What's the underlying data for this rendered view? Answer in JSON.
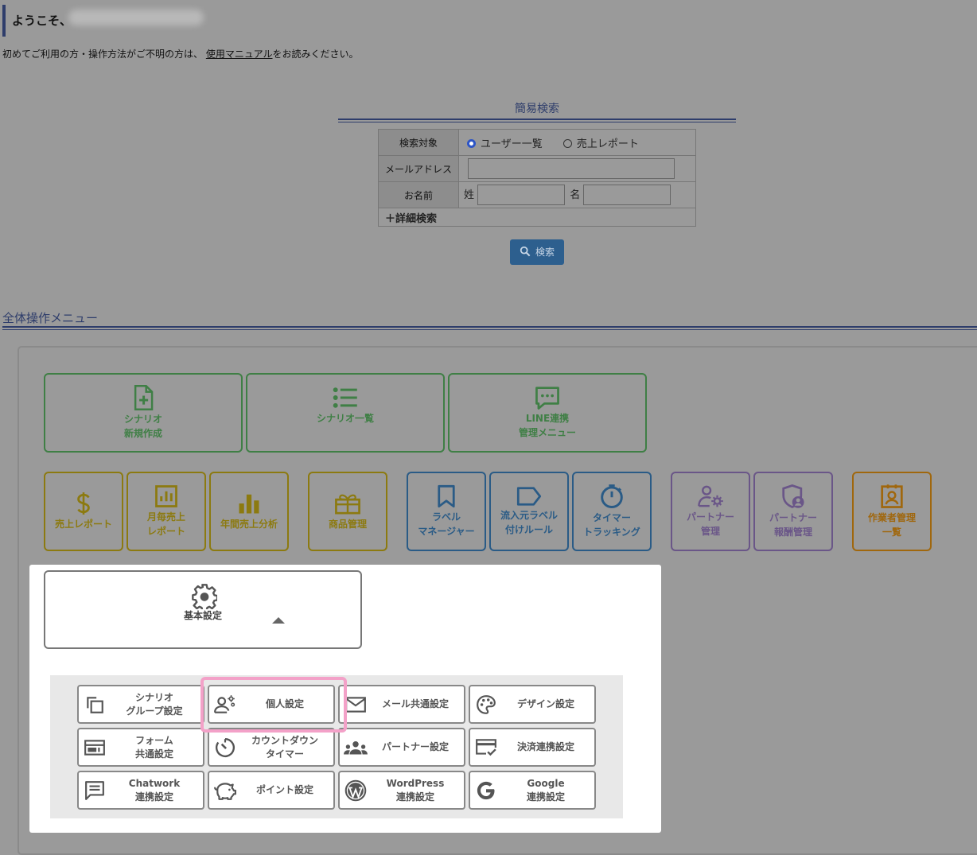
{
  "header": {
    "welcome": "ようこそ、",
    "intro_prefix": "初めてご利用の方・操作方法がご不明の方は、",
    "manual_link": "使用マニュアル",
    "intro_suffix": "をお読みください。"
  },
  "quick_search": {
    "title": "簡易検索",
    "target_label": "検索対象",
    "option_users": "ユーザー一覧",
    "option_sales": "売上レポート",
    "email_label": "メールアドレス",
    "email_value": "",
    "name_label": "お名前",
    "last_name_label": "姓",
    "first_name_label": "名",
    "advanced": "＋詳細検索",
    "search_button": "検索"
  },
  "menu": {
    "title": "全体操作メニュー",
    "row1": [
      {
        "label": "シナリオ\n新規作成",
        "icon": "file-plus-icon"
      },
      {
        "label": "シナリオ一覧",
        "icon": "list-icon"
      },
      {
        "label": "LINE連携\n管理メニュー",
        "icon": "chat-icon"
      }
    ],
    "row2": [
      {
        "label": "売上レポート",
        "icon": "dollar-icon"
      },
      {
        "label": "月毎売上\nレポート",
        "icon": "chart-box-icon"
      },
      {
        "label": "年間売上分析",
        "icon": "bar-chart-icon"
      },
      {
        "label": "商品管理",
        "icon": "gift-icon"
      },
      {
        "label": "ラベル\nマネージャー",
        "icon": "bookmark-icon"
      },
      {
        "label": "流入元ラベル\n付けルール",
        "icon": "tag-icon"
      },
      {
        "label": "タイマー\nトラッキング",
        "icon": "timer-icon"
      },
      {
        "label": "パートナー\n管理",
        "icon": "user-gear-icon"
      },
      {
        "label": "パートナー\n報酬管理",
        "icon": "shield-user-icon"
      },
      {
        "label": "作業者管理\n一覧",
        "icon": "id-badge-icon"
      }
    ],
    "basic": {
      "label": "基本設定",
      "icon": "gear-icon"
    },
    "settings": [
      {
        "label": "シナリオ\nグループ設定",
        "icon": "copy-icon"
      },
      {
        "label": "個人設定",
        "icon": "user-gears-icon"
      },
      {
        "label": "メール共通設定",
        "icon": "mail-icon"
      },
      {
        "label": "デザイン設定",
        "icon": "palette-icon"
      },
      {
        "label": "フォーム\n共通設定",
        "icon": "form-icon"
      },
      {
        "label": "カウントダウン\nタイマー",
        "icon": "countdown-icon"
      },
      {
        "label": "パートナー設定",
        "icon": "users-icon"
      },
      {
        "label": "決済連携設定",
        "icon": "card-icon"
      },
      {
        "label": "Chatwork\n連携設定",
        "icon": "message-icon"
      },
      {
        "label": "ポイント設定",
        "icon": "piggy-icon"
      },
      {
        "label": "WordPress\n連携設定",
        "icon": "wordpress-icon"
      },
      {
        "label": "Google\n連携設定",
        "icon": "google-icon"
      }
    ]
  }
}
